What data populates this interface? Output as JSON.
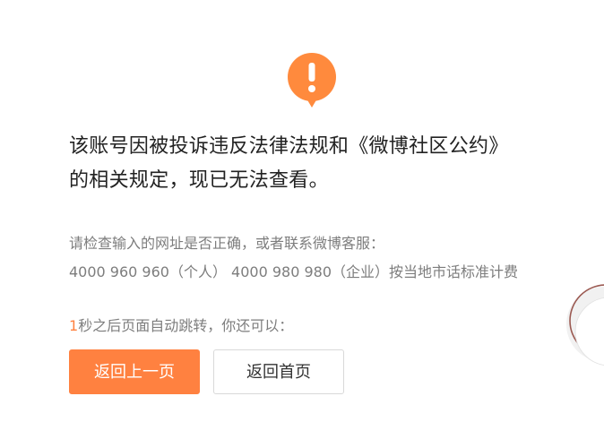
{
  "notice": {
    "headline_line1": "该账号因被投诉违反法律法规和《微博社区公约》",
    "headline_line2": "的相关规定，现已无法查看。"
  },
  "help": {
    "line1": "请检查输入的网址是否正确，或者联系微博客服：",
    "line2": "4000 960 960（个人） 4000 980 980（企业）按当地市话标准计费"
  },
  "redirect": {
    "countdown": "1",
    "text": "秒之后页面自动跳转，你还可以："
  },
  "buttons": {
    "back_label": "返回上一页",
    "home_label": "返回首页"
  },
  "colors": {
    "accent": "#ff8140",
    "text_primary": "#222222",
    "text_secondary": "#7d7d7d"
  },
  "icons": {
    "alert": "exclamation-bubble-icon"
  }
}
